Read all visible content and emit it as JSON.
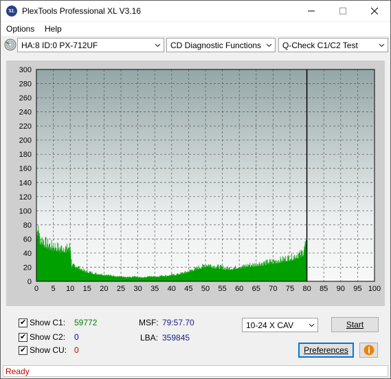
{
  "window": {
    "title": "PlexTools Professional XL V3.16",
    "app_icon_text": "XL"
  },
  "menu": {
    "items": [
      "Options",
      "Help"
    ]
  },
  "toolbar": {
    "drive": "HA:8 ID:0  PX-712UF",
    "function": "CD Diagnostic Functions",
    "test": "Q-Check C1/C2 Test"
  },
  "chart_data": {
    "type": "area",
    "x_ticks": [
      "0",
      "5",
      "10",
      "15",
      "20",
      "25",
      "30",
      "35",
      "40",
      "45",
      "50",
      "55",
      "60",
      "65",
      "70",
      "75",
      "80",
      "85",
      "90",
      "95",
      "100"
    ],
    "y_ticks": [
      "0",
      "20",
      "40",
      "60",
      "80",
      "100",
      "120",
      "140",
      "160",
      "180",
      "200",
      "220",
      "240",
      "260",
      "280",
      "300"
    ],
    "xlim": [
      0,
      100
    ],
    "ylim": [
      0,
      300
    ],
    "grid": true,
    "end_marker_x": 80,
    "series": [
      {
        "color": "#00a000",
        "x": [
          0,
          0.5,
          1,
          2,
          3,
          4,
          5,
          6,
          7,
          8,
          9,
          10,
          10.5,
          11,
          12,
          13,
          14,
          15,
          16,
          17,
          18,
          19,
          20,
          21,
          22,
          23,
          24,
          25,
          26,
          27,
          28,
          29,
          30,
          31,
          32,
          33,
          34,
          35,
          36,
          37,
          38,
          39,
          40,
          41,
          42,
          43,
          44,
          45,
          46,
          47,
          48,
          49,
          50,
          51,
          52,
          53,
          54,
          55,
          56,
          57,
          58,
          59,
          60,
          61,
          62,
          63,
          64,
          65,
          66,
          67,
          68,
          69,
          70,
          71,
          72,
          73,
          74,
          75,
          76,
          77,
          78,
          79,
          79.5,
          79.9
        ],
        "values": [
          58,
          62,
          52,
          50,
          46,
          44,
          43,
          42,
          40,
          41,
          40,
          42,
          16,
          20,
          18,
          16,
          13,
          12,
          11,
          10,
          9,
          9,
          8,
          8,
          7,
          7,
          6,
          6,
          5,
          5,
          5,
          6,
          5,
          5,
          5,
          6,
          6,
          6,
          6,
          7,
          7,
          7,
          8,
          8,
          9,
          10,
          11,
          12,
          14,
          15,
          17,
          18,
          20,
          20,
          19,
          18,
          18,
          17,
          16,
          16,
          16,
          17,
          18,
          18,
          19,
          20,
          20,
          21,
          22,
          22,
          23,
          24,
          24,
          25,
          26,
          27,
          28,
          29,
          30,
          32,
          33,
          36,
          42,
          50
        ]
      }
    ]
  },
  "stats": {
    "c1_label": "Show C1:",
    "c1_value": "59772",
    "c1_color": "#008000",
    "c2_label": "Show C2:",
    "c2_value": "0",
    "c2_color": "#0000c0",
    "cu_label": "Show CU:",
    "cu_value": "0",
    "cu_color": "#c00000",
    "msf_label": "MSF:",
    "msf_value": "79:57.70",
    "lba_label": "LBA:",
    "lba_value": "359845"
  },
  "controls": {
    "speed": "10-24 X CAV",
    "start_label": "Start",
    "preferences_label": "Preferences"
  },
  "status": {
    "text": "Ready"
  }
}
